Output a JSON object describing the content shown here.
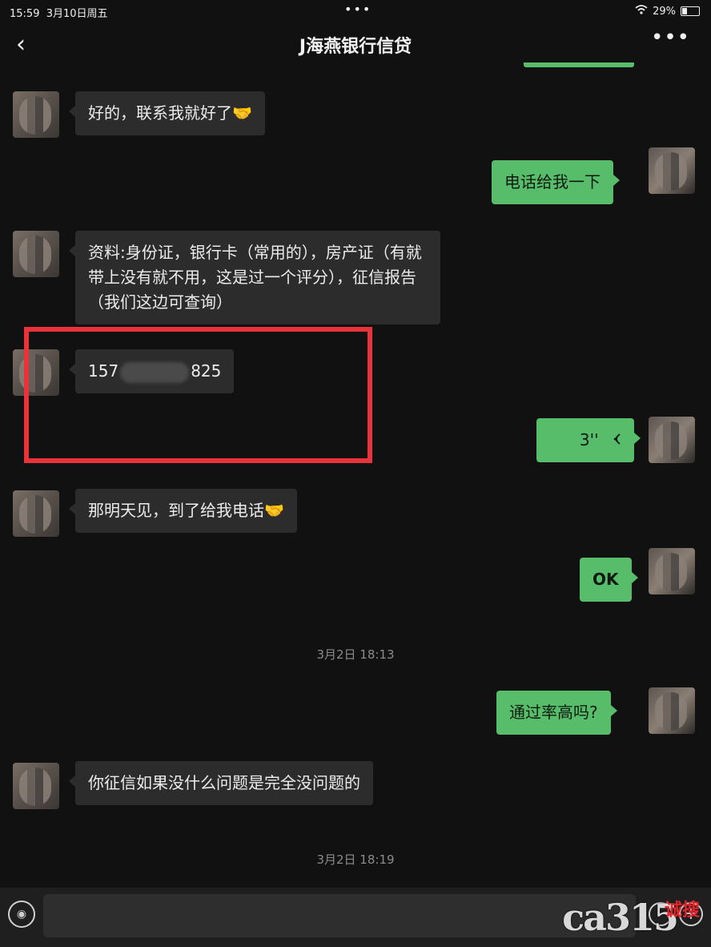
{
  "status_bar": {
    "time": "15:59",
    "date": "3月10日周五",
    "center_dots": "•••",
    "battery": "29%",
    "battery_fraction": 0.29
  },
  "header": {
    "back_label": "‹",
    "title": "J海燕银行信贷",
    "more_label": "•••"
  },
  "messages": [
    {
      "side": "in",
      "text": "好的，联系我就好了🤝"
    },
    {
      "side": "out",
      "text": "电话给我一下"
    },
    {
      "side": "in",
      "text": "资料:身份证，银行卡（常用的），房产证（有就带上没有就不用，这是过一个评分），征信报告（我们这边可查询）"
    },
    {
      "side": "in",
      "phone_prefix": "157",
      "phone_suffix": "825"
    },
    {
      "side": "out",
      "voice_duration": "3''"
    },
    {
      "side": "in",
      "text": "那明天见，到了给我电话🤝"
    },
    {
      "side": "out",
      "text": "OK"
    },
    {
      "side": "out",
      "text": "通过率高吗?"
    },
    {
      "side": "in",
      "text": "你征信如果没什么问题是完全没问题的"
    }
  ],
  "timestamps": [
    "3月2日 18:13",
    "3月2日 18:19"
  ],
  "watermark": {
    "logo": "ca315",
    "text": "诚搜"
  },
  "colors": {
    "out_bubble": "#58bd6a",
    "in_bubble": "#2c2c2c",
    "highlight_box": "#e8333a",
    "background": "#111111"
  }
}
